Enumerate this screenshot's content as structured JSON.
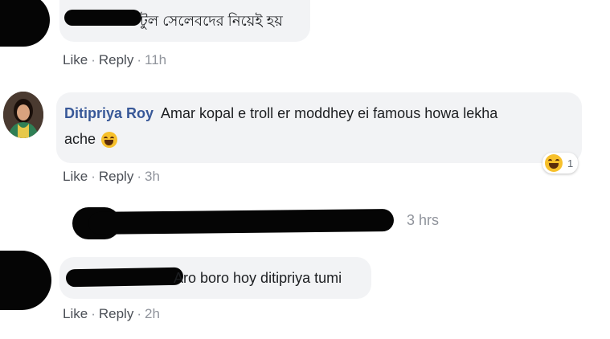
{
  "comments": [
    {
      "author": "",
      "text": "টুল সেলেবদের নিয়েই হয়",
      "actions": {
        "like": "Like",
        "reply": "Reply",
        "separator": "·",
        "time": "11h"
      }
    },
    {
      "author": "Ditipriya Roy",
      "text_line1": "Amar kopal e troll er moddhey ei famous howa lekha",
      "text_line2": "ache",
      "text_emoji": "laughing-crying-emoji",
      "reaction": {
        "icon": "laughing-emoji",
        "count": "1"
      },
      "actions": {
        "like": "Like",
        "reply": "Reply",
        "separator": "·",
        "time": "3h"
      }
    },
    {
      "author": "",
      "reply_time": "3 hrs"
    },
    {
      "author": "",
      "text": "Aro boro hoy ditipriya tumi",
      "actions": {
        "like": "Like",
        "reply": "Reply",
        "separator": "·",
        "time": "2h"
      }
    }
  ],
  "colors": {
    "author_link": "#385898",
    "bubble_bg": "#f2f3f5",
    "meta_text": "#90949c",
    "redaction": "#050505"
  }
}
